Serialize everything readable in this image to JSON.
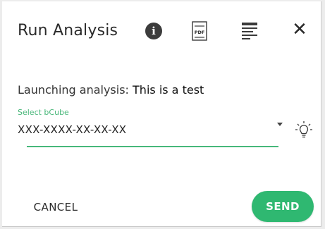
{
  "dialog": {
    "title": "Run Analysis",
    "icons": {
      "info": "info-icon",
      "pdf": "pdf-icon",
      "list": "list-icon",
      "close": "close-icon",
      "bulb": "lightbulb-icon"
    },
    "info_glyph": "i",
    "close_glyph": "✕",
    "pdf_text": "PDF"
  },
  "launch": {
    "prefix": "Launching analysis: ",
    "name": "This is a test"
  },
  "field": {
    "label": "Select bCube",
    "value": "XXX-XXXX-XX-XX-XX"
  },
  "buttons": {
    "cancel": "CANCEL",
    "send": "SEND"
  },
  "colors": {
    "accent": "#2fb871",
    "label": "#49b77a"
  }
}
